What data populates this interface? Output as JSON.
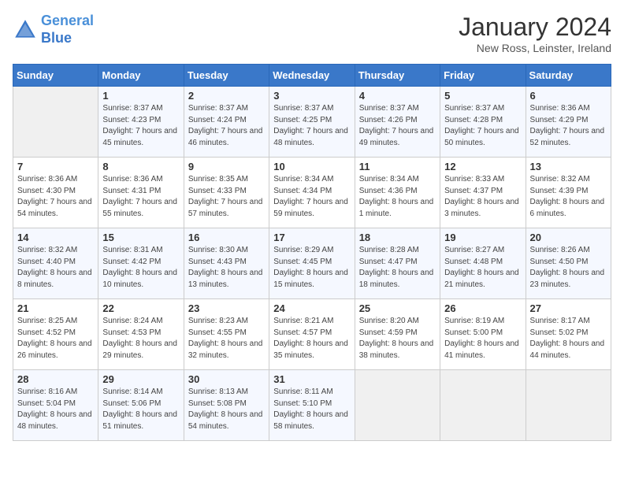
{
  "header": {
    "logo_line1": "General",
    "logo_line2": "Blue",
    "month": "January 2024",
    "location": "New Ross, Leinster, Ireland"
  },
  "days_of_week": [
    "Sunday",
    "Monday",
    "Tuesday",
    "Wednesday",
    "Thursday",
    "Friday",
    "Saturday"
  ],
  "weeks": [
    [
      {
        "day": "",
        "sunrise": "",
        "sunset": "",
        "daylight": ""
      },
      {
        "day": "1",
        "sunrise": "Sunrise: 8:37 AM",
        "sunset": "Sunset: 4:23 PM",
        "daylight": "Daylight: 7 hours and 45 minutes."
      },
      {
        "day": "2",
        "sunrise": "Sunrise: 8:37 AM",
        "sunset": "Sunset: 4:24 PM",
        "daylight": "Daylight: 7 hours and 46 minutes."
      },
      {
        "day": "3",
        "sunrise": "Sunrise: 8:37 AM",
        "sunset": "Sunset: 4:25 PM",
        "daylight": "Daylight: 7 hours and 48 minutes."
      },
      {
        "day": "4",
        "sunrise": "Sunrise: 8:37 AM",
        "sunset": "Sunset: 4:26 PM",
        "daylight": "Daylight: 7 hours and 49 minutes."
      },
      {
        "day": "5",
        "sunrise": "Sunrise: 8:37 AM",
        "sunset": "Sunset: 4:28 PM",
        "daylight": "Daylight: 7 hours and 50 minutes."
      },
      {
        "day": "6",
        "sunrise": "Sunrise: 8:36 AM",
        "sunset": "Sunset: 4:29 PM",
        "daylight": "Daylight: 7 hours and 52 minutes."
      }
    ],
    [
      {
        "day": "7",
        "sunrise": "Sunrise: 8:36 AM",
        "sunset": "Sunset: 4:30 PM",
        "daylight": "Daylight: 7 hours and 54 minutes."
      },
      {
        "day": "8",
        "sunrise": "Sunrise: 8:36 AM",
        "sunset": "Sunset: 4:31 PM",
        "daylight": "Daylight: 7 hours and 55 minutes."
      },
      {
        "day": "9",
        "sunrise": "Sunrise: 8:35 AM",
        "sunset": "Sunset: 4:33 PM",
        "daylight": "Daylight: 7 hours and 57 minutes."
      },
      {
        "day": "10",
        "sunrise": "Sunrise: 8:34 AM",
        "sunset": "Sunset: 4:34 PM",
        "daylight": "Daylight: 7 hours and 59 minutes."
      },
      {
        "day": "11",
        "sunrise": "Sunrise: 8:34 AM",
        "sunset": "Sunset: 4:36 PM",
        "daylight": "Daylight: 8 hours and 1 minute."
      },
      {
        "day": "12",
        "sunrise": "Sunrise: 8:33 AM",
        "sunset": "Sunset: 4:37 PM",
        "daylight": "Daylight: 8 hours and 3 minutes."
      },
      {
        "day": "13",
        "sunrise": "Sunrise: 8:32 AM",
        "sunset": "Sunset: 4:39 PM",
        "daylight": "Daylight: 8 hours and 6 minutes."
      }
    ],
    [
      {
        "day": "14",
        "sunrise": "Sunrise: 8:32 AM",
        "sunset": "Sunset: 4:40 PM",
        "daylight": "Daylight: 8 hours and 8 minutes."
      },
      {
        "day": "15",
        "sunrise": "Sunrise: 8:31 AM",
        "sunset": "Sunset: 4:42 PM",
        "daylight": "Daylight: 8 hours and 10 minutes."
      },
      {
        "day": "16",
        "sunrise": "Sunrise: 8:30 AM",
        "sunset": "Sunset: 4:43 PM",
        "daylight": "Daylight: 8 hours and 13 minutes."
      },
      {
        "day": "17",
        "sunrise": "Sunrise: 8:29 AM",
        "sunset": "Sunset: 4:45 PM",
        "daylight": "Daylight: 8 hours and 15 minutes."
      },
      {
        "day": "18",
        "sunrise": "Sunrise: 8:28 AM",
        "sunset": "Sunset: 4:47 PM",
        "daylight": "Daylight: 8 hours and 18 minutes."
      },
      {
        "day": "19",
        "sunrise": "Sunrise: 8:27 AM",
        "sunset": "Sunset: 4:48 PM",
        "daylight": "Daylight: 8 hours and 21 minutes."
      },
      {
        "day": "20",
        "sunrise": "Sunrise: 8:26 AM",
        "sunset": "Sunset: 4:50 PM",
        "daylight": "Daylight: 8 hours and 23 minutes."
      }
    ],
    [
      {
        "day": "21",
        "sunrise": "Sunrise: 8:25 AM",
        "sunset": "Sunset: 4:52 PM",
        "daylight": "Daylight: 8 hours and 26 minutes."
      },
      {
        "day": "22",
        "sunrise": "Sunrise: 8:24 AM",
        "sunset": "Sunset: 4:53 PM",
        "daylight": "Daylight: 8 hours and 29 minutes."
      },
      {
        "day": "23",
        "sunrise": "Sunrise: 8:23 AM",
        "sunset": "Sunset: 4:55 PM",
        "daylight": "Daylight: 8 hours and 32 minutes."
      },
      {
        "day": "24",
        "sunrise": "Sunrise: 8:21 AM",
        "sunset": "Sunset: 4:57 PM",
        "daylight": "Daylight: 8 hours and 35 minutes."
      },
      {
        "day": "25",
        "sunrise": "Sunrise: 8:20 AM",
        "sunset": "Sunset: 4:59 PM",
        "daylight": "Daylight: 8 hours and 38 minutes."
      },
      {
        "day": "26",
        "sunrise": "Sunrise: 8:19 AM",
        "sunset": "Sunset: 5:00 PM",
        "daylight": "Daylight: 8 hours and 41 minutes."
      },
      {
        "day": "27",
        "sunrise": "Sunrise: 8:17 AM",
        "sunset": "Sunset: 5:02 PM",
        "daylight": "Daylight: 8 hours and 44 minutes."
      }
    ],
    [
      {
        "day": "28",
        "sunrise": "Sunrise: 8:16 AM",
        "sunset": "Sunset: 5:04 PM",
        "daylight": "Daylight: 8 hours and 48 minutes."
      },
      {
        "day": "29",
        "sunrise": "Sunrise: 8:14 AM",
        "sunset": "Sunset: 5:06 PM",
        "daylight": "Daylight: 8 hours and 51 minutes."
      },
      {
        "day": "30",
        "sunrise": "Sunrise: 8:13 AM",
        "sunset": "Sunset: 5:08 PM",
        "daylight": "Daylight: 8 hours and 54 minutes."
      },
      {
        "day": "31",
        "sunrise": "Sunrise: 8:11 AM",
        "sunset": "Sunset: 5:10 PM",
        "daylight": "Daylight: 8 hours and 58 minutes."
      },
      {
        "day": "",
        "sunrise": "",
        "sunset": "",
        "daylight": ""
      },
      {
        "day": "",
        "sunrise": "",
        "sunset": "",
        "daylight": ""
      },
      {
        "day": "",
        "sunrise": "",
        "sunset": "",
        "daylight": ""
      }
    ]
  ]
}
